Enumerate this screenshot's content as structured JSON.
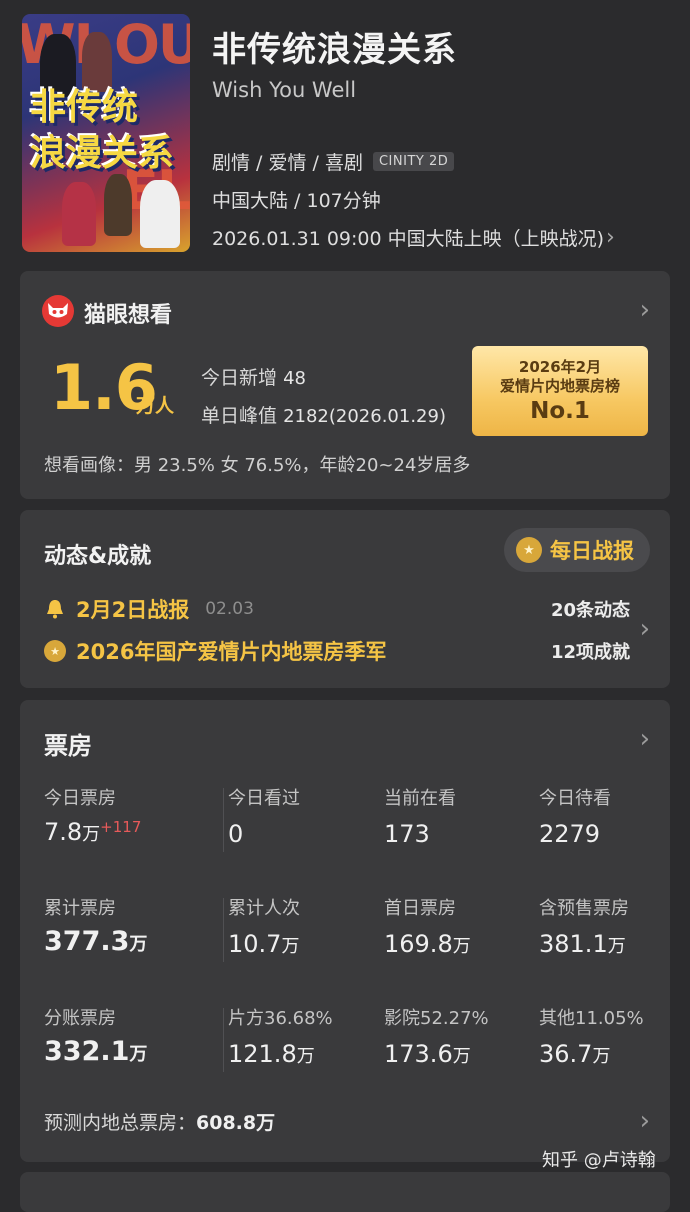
{
  "header": {
    "poster_title_line1": "非传统",
    "poster_title_line2": "浪漫关系",
    "title": "非传统浪漫关系",
    "subtitle": "Wish You Well",
    "genres": "剧情 / 爱情 / 喜剧",
    "format_badge": "CINITY 2D",
    "region_duration": "中国大陆 / 107分钟",
    "release": "2026.01.31 09:00 中国大陆上映（上映战况)"
  },
  "want": {
    "title": "猫眼想看",
    "count": "1.6",
    "count_unit": "万人",
    "today_label": "今日新增",
    "today_value": "48",
    "peak_label": "单日峰值",
    "peak_value": "2182(2026.01.29)",
    "rank_line1": "2026年2月",
    "rank_line2": "爱情片内地票房榜",
    "rank_value": "No.1",
    "portrait": "想看画像：男 23.5%  女 76.5%，年龄20~24岁居多"
  },
  "dynamics": {
    "title": "动态&成就",
    "daily_button": "每日战报",
    "item1_text": "2月2日战报",
    "item1_date": "02.03",
    "item2_text": "2026年国产爱情片内地票房季军",
    "count1": "20条动态",
    "count2": "12项成就"
  },
  "box_office": {
    "title": "票房",
    "rows": [
      [
        {
          "label": "今日票房",
          "value": "7.8",
          "unit": "万",
          "increase": "+117"
        },
        {
          "label": "今日看过",
          "value": "0"
        },
        {
          "label": "当前在看",
          "value": "173"
        },
        {
          "label": "今日待看",
          "value": "2279"
        }
      ],
      [
        {
          "label": "累计票房",
          "value": "377.3",
          "unit": "万"
        },
        {
          "label": "累计人次",
          "value": "10.7",
          "unit": "万"
        },
        {
          "label": "首日票房",
          "value": "169.8",
          "unit": "万"
        },
        {
          "label": "含预售票房",
          "value": "381.1",
          "unit": "万"
        }
      ],
      [
        {
          "label": "分账票房",
          "value": "332.1",
          "unit": "万"
        },
        {
          "label": "片方36.68%",
          "value": "121.8",
          "unit": "万"
        },
        {
          "label": "影院52.27%",
          "value": "173.6",
          "unit": "万"
        },
        {
          "label": "其他11.05%",
          "value": "36.7",
          "unit": "万"
        }
      ]
    ],
    "forecast_label": "预测内地总票房：",
    "forecast_value": "608.8万"
  },
  "watermark": "知乎 @卢诗翰",
  "colors": {
    "accent": "#f5c445",
    "card": "#3a3a3c",
    "background": "#2b2b2d",
    "increase": "#e65a5a"
  },
  "icons": [
    "cat-logo-icon",
    "chevron-right-icon",
    "bell-icon",
    "medal-icon"
  ]
}
